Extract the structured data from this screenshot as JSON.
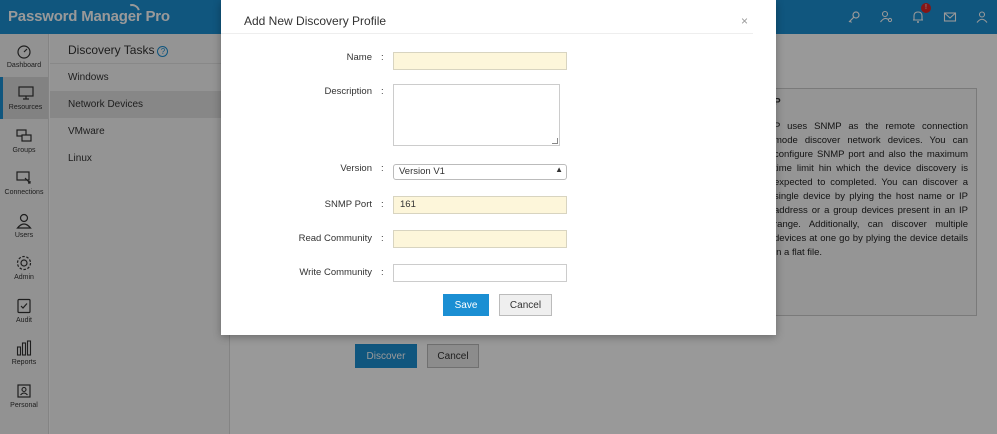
{
  "app": {
    "title": "Password Manager Pro",
    "colors": {
      "accent": "#1b8fd3",
      "input_highlight": "#fdf6da"
    }
  },
  "top_icons": [
    {
      "name": "key-icon"
    },
    {
      "name": "user-search-icon"
    },
    {
      "name": "notification-bell-icon",
      "badge": "!"
    },
    {
      "name": "mail-icon"
    },
    {
      "name": "user-icon"
    }
  ],
  "sidebar": {
    "items": [
      {
        "label": "Dashboard",
        "icon": "dashboard-icon"
      },
      {
        "label": "Resources",
        "icon": "monitor-icon",
        "active": true
      },
      {
        "label": "Groups",
        "icon": "groups-icon"
      },
      {
        "label": "Connections",
        "icon": "connections-icon"
      },
      {
        "label": "Users",
        "icon": "users-icon"
      },
      {
        "label": "Admin",
        "icon": "gear-icon"
      },
      {
        "label": "Audit",
        "icon": "audit-icon"
      },
      {
        "label": "Reports",
        "icon": "reports-icon"
      },
      {
        "label": "Personal",
        "icon": "personal-icon"
      }
    ]
  },
  "subnav": {
    "title": "Discovery Tasks",
    "help": "?",
    "items": [
      "Windows",
      "Network Devices",
      "VMware",
      "Linux"
    ]
  },
  "main": {
    "help_title": "P",
    "help_text": "P uses SNMP as the remote connection mode discover network devices. You can configure SNMP port and also the maximum time limit hin which the device discovery is expected to completed. You can discover a single device by plying the host name or IP address or a group devices present in an IP range. Additionally, can discover multiple devices at one go by plying the device details in a flat file.",
    "discover_label": "Discover",
    "cancel_label": "Cancel"
  },
  "modal": {
    "title": "Add New Discovery Profile",
    "close": "×",
    "fields": {
      "name_label": "Name",
      "description_label": "Description",
      "version_label": "Version",
      "version_value": "Version V1",
      "snmp_port_label": "SNMP Port",
      "snmp_port_value": "161",
      "read_community_label": "Read Community",
      "write_community_label": "Write Community"
    },
    "colon": ":",
    "save_label": "Save",
    "cancel_label": "Cancel"
  }
}
